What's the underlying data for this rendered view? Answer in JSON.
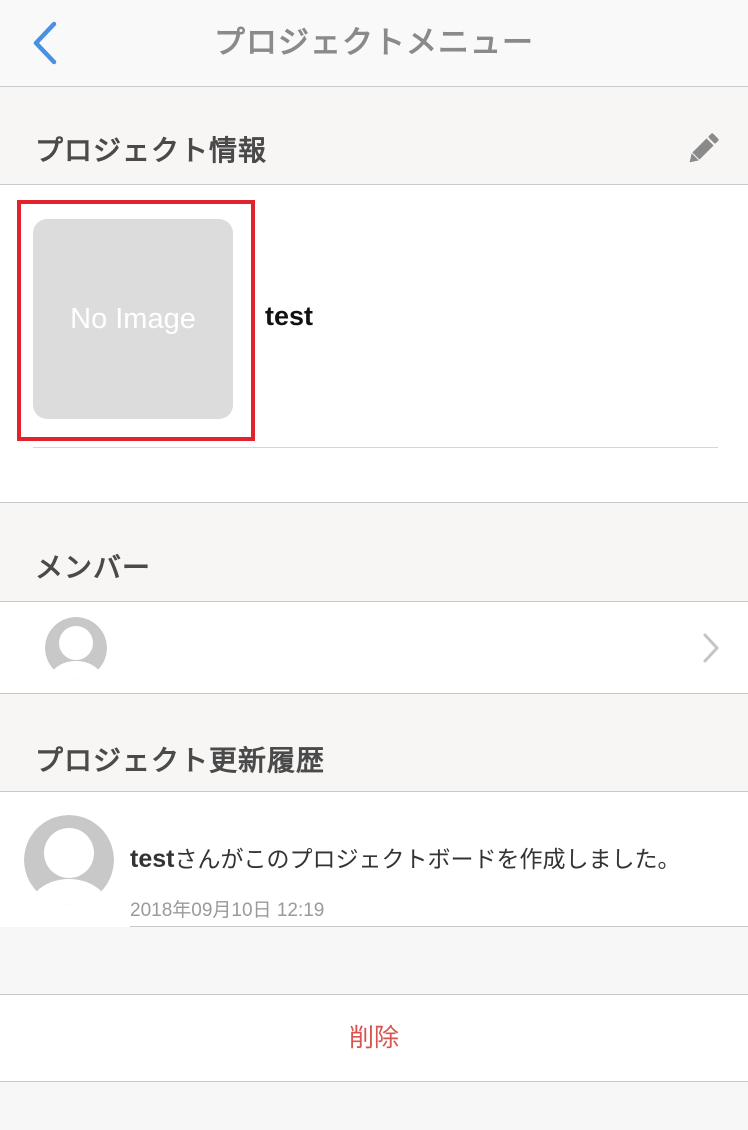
{
  "navbar": {
    "title": "プロジェクトメニュー",
    "back_icon": "chevron-left-icon"
  },
  "project_info": {
    "header": "プロジェクト情報",
    "edit_icon": "pencil-icon",
    "image_placeholder": "No Image",
    "name": "test"
  },
  "members": {
    "header": "メンバー",
    "avatar_icon": "user-avatar-icon",
    "chevron_icon": "chevron-right-icon"
  },
  "history": {
    "header": "プロジェクト更新履歴",
    "items": [
      {
        "user": "test",
        "message": "さんがこのプロジェクトボードを作成しました。",
        "datetime": "2018年09月10日 12:19"
      }
    ]
  },
  "actions": {
    "delete_label": "削除"
  },
  "colors": {
    "accent": "#4a90e2",
    "highlight": "#e0232c",
    "destructive": "#d9534f"
  }
}
